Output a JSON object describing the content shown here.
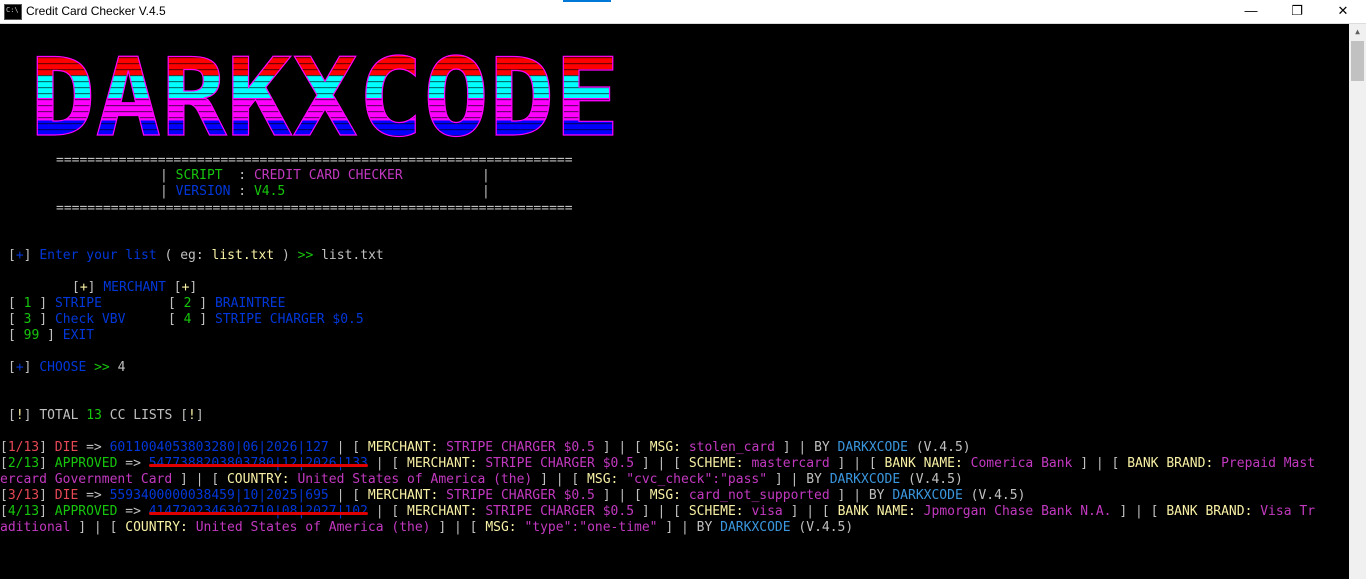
{
  "window": {
    "title": "Credit Card Checker V.4.5",
    "app_icon": "C:\\",
    "minimize_icon": "—",
    "maximize_icon": "❐",
    "close_icon": "✕"
  },
  "banner": {
    "text": "DARKXCODE",
    "colors": [
      "#ff0000",
      "#00ffff",
      "#ff00ff",
      "#0000ff"
    ]
  },
  "header": {
    "rule": "==================================================================",
    "script_label": "SCRIPT",
    "script_sep": ":",
    "script_value": "CREDIT CARD CHECKER",
    "version_label": "VERSION",
    "version_sep": ":",
    "version_value": "V4.5"
  },
  "prompt_list": {
    "marker": "+",
    "text": "Enter your list",
    "eg_open": "( eg:",
    "eg_file": "list.txt",
    "eg_close": ")",
    "arrow": ">>",
    "input": "list.txt"
  },
  "merchant_menu": {
    "title": "MERCHANT",
    "marker": "+",
    "options": [
      {
        "num": "1",
        "label": "STRIPE"
      },
      {
        "num": "2",
        "label": "BRAINTREE"
      },
      {
        "num": "3",
        "label": "Check VBV"
      },
      {
        "num": "4",
        "label": "STRIPE CHARGER $0.5"
      },
      {
        "num": "99",
        "label": "EXIT"
      }
    ]
  },
  "choose": {
    "marker": "+",
    "label": "CHOOSE",
    "arrow": ">>",
    "value": "4"
  },
  "total": {
    "marker": "!",
    "prefix": "TOTAL",
    "count": "13",
    "suffix": "CC LISTS"
  },
  "results": [
    {
      "index": "1/13",
      "status": "DIE",
      "arrow": "=>",
      "card": "6011004053803280|06|2026|127",
      "merchant_label": "MERCHANT:",
      "merchant": "STRIPE CHARGER $0.5",
      "msg_label": "MSG:",
      "msg": "stolen_card",
      "by": "BY",
      "author": "DARKXCODE",
      "version": "(V.4.5)"
    },
    {
      "index": "2/13",
      "status": "APPROVED",
      "arrow": "=>",
      "card": "5477388203803780|12|2026|133",
      "merchant_label": "MERCHANT:",
      "merchant": "STRIPE CHARGER $0.5",
      "scheme_label": "SCHEME:",
      "scheme": "mastercard",
      "bank_label": "BANK NAME:",
      "bank": "Comerica Bank",
      "brand_label": "BANK BRAND:",
      "brand_a": "Prepaid Mast",
      "brand_b": "ercard Government Card",
      "country_label": "COUNTRY:",
      "country": "United States of America (the)",
      "msg_label": "MSG:",
      "msg": "\"cvc_check\":\"pass\"",
      "by": "BY",
      "author": "DARKXCODE",
      "version": "(V.4.5)"
    },
    {
      "index": "3/13",
      "status": "DIE",
      "arrow": "=>",
      "card": "5593400000038459|10|2025|695",
      "merchant_label": "MERCHANT:",
      "merchant": "STRIPE CHARGER $0.5",
      "msg_label": "MSG:",
      "msg": "card_not_supported",
      "by": "BY",
      "author": "DARKXCODE",
      "version": "(V.4.5)"
    },
    {
      "index": "4/13",
      "status": "APPROVED",
      "arrow": "=>",
      "card": "4147202346302710|08|2027|102",
      "merchant_label": "MERCHANT:",
      "merchant": "STRIPE CHARGER $0.5",
      "scheme_label": "SCHEME:",
      "scheme": "visa",
      "bank_label": "BANK NAME:",
      "bank": "Jpmorgan Chase Bank N.A.",
      "brand_label": "BANK BRAND:",
      "brand_a": "Visa Tr",
      "brand_b": "aditional",
      "country_label": "COUNTRY:",
      "country": "United States of America (the)",
      "msg_label": "MSG:",
      "msg": "\"type\":\"one-time\"",
      "by": "BY",
      "author": "DARKXCODE",
      "version": "(V.4.5)"
    }
  ]
}
